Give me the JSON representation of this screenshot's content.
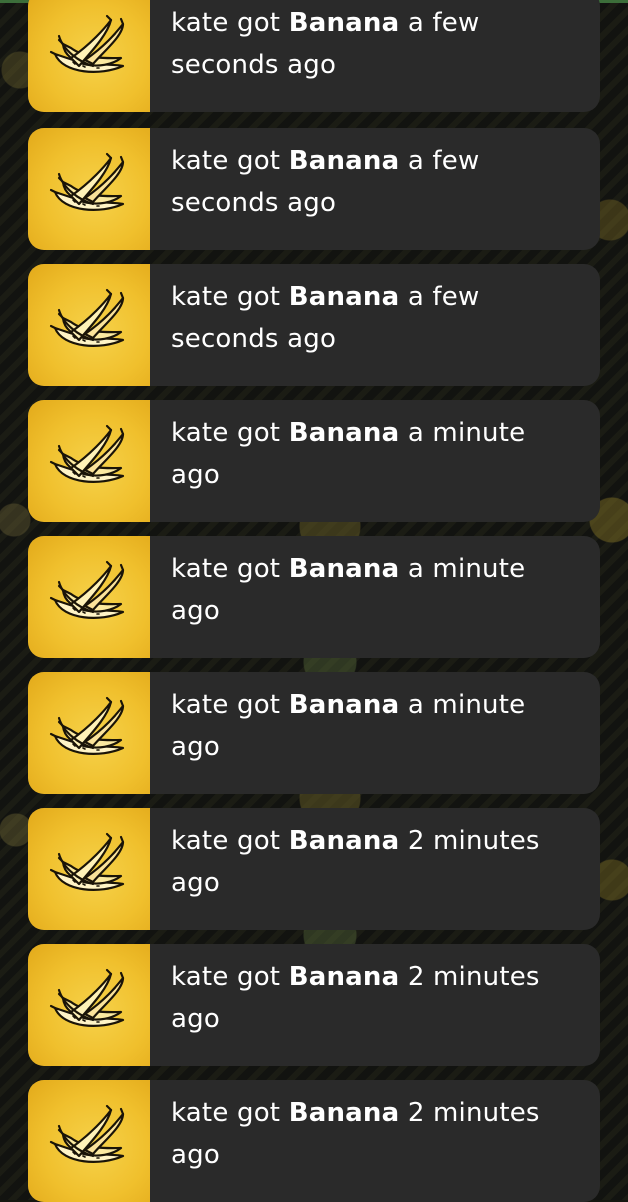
{
  "feed": {
    "items": [
      {
        "user": "kate",
        "verb": "got",
        "item": "Banana",
        "time_line1": "a few",
        "time_line2": "seconds ago",
        "icon": "banana-bunch-icon"
      },
      {
        "user": "kate",
        "verb": "got",
        "item": "Banana",
        "time_line1": "a few",
        "time_line2": "seconds ago",
        "icon": "banana-bunch-icon"
      },
      {
        "user": "kate",
        "verb": "got",
        "item": "Banana",
        "time_line1": "a few",
        "time_line2": "seconds ago",
        "icon": "banana-bunch-icon"
      },
      {
        "user": "kate",
        "verb": "got",
        "item": "Banana",
        "time_line1": "a minute",
        "time_line2": "ago",
        "icon": "banana-bunch-icon"
      },
      {
        "user": "kate",
        "verb": "got",
        "item": "Banana",
        "time_line1": "a minute",
        "time_line2": "ago",
        "icon": "banana-bunch-icon"
      },
      {
        "user": "kate",
        "verb": "got",
        "item": "Banana",
        "time_line1": "a minute",
        "time_line2": "ago",
        "icon": "banana-bunch-icon"
      },
      {
        "user": "kate",
        "verb": "got",
        "item": "Banana",
        "time_line1": "2 minutes",
        "time_line2": "ago",
        "icon": "banana-bunch-icon"
      },
      {
        "user": "kate",
        "verb": "got",
        "item": "Banana",
        "time_line1": "2 minutes",
        "time_line2": "ago",
        "icon": "banana-bunch-icon"
      },
      {
        "user": "kate",
        "verb": "got",
        "item": "Banana",
        "time_line1": "2 minutes",
        "time_line2": "ago",
        "icon": "banana-bunch-icon"
      }
    ]
  },
  "colors": {
    "card_bg": "#2a2a2a",
    "thumb_yellow": "#f0c02d",
    "text": "#ffffff"
  }
}
